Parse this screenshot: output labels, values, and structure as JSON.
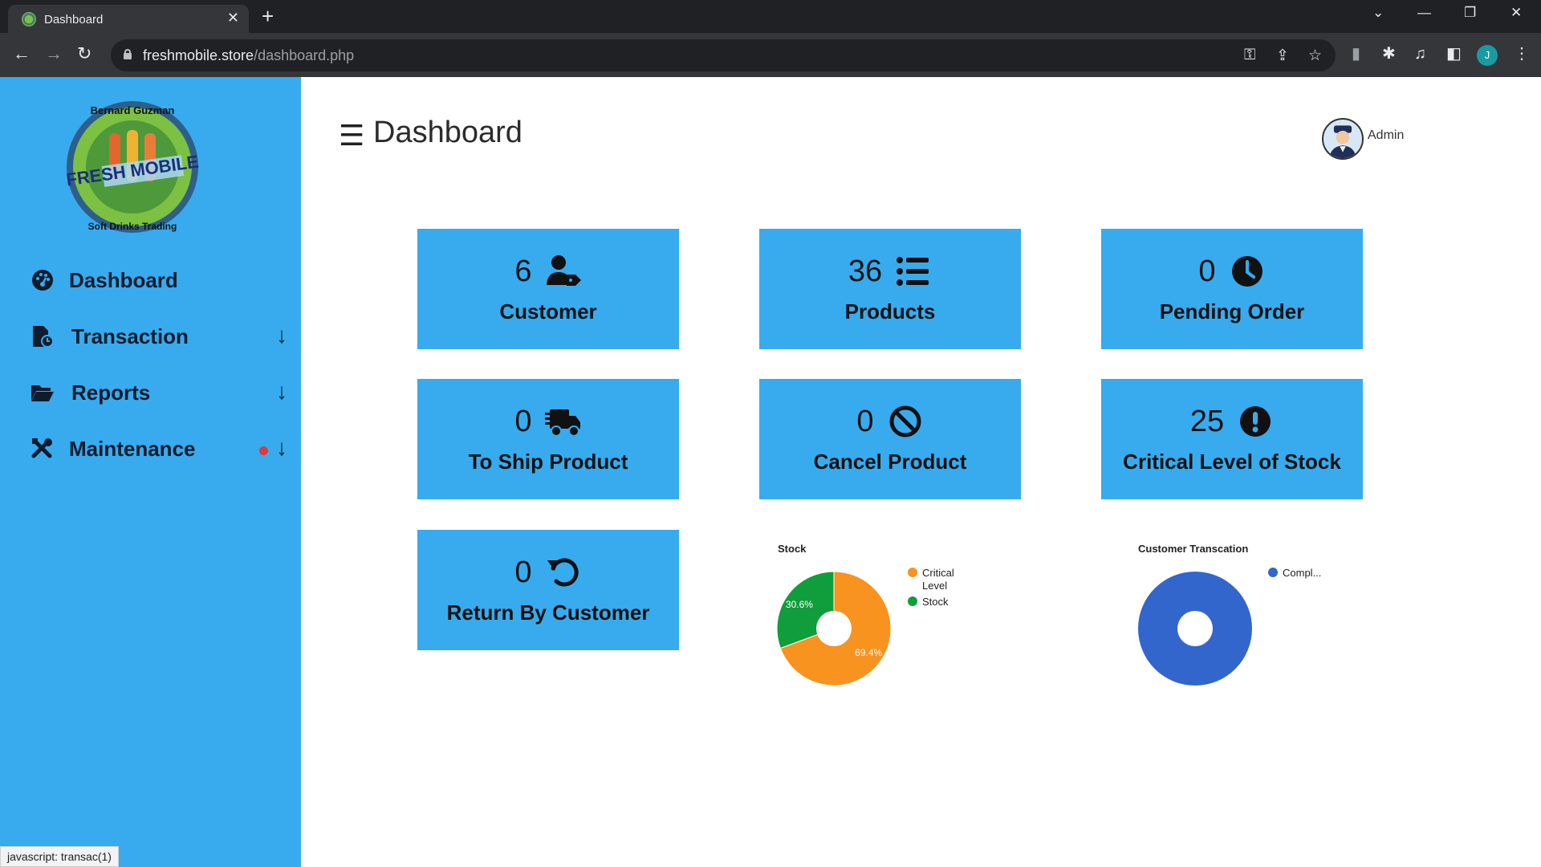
{
  "browser": {
    "tab_title": "Dashboard",
    "url_host": "freshmobile.store",
    "url_path": "/dashboard.php",
    "profile_initial": "J"
  },
  "sidebar": {
    "logo": {
      "top_text": "Bernard Guzman",
      "brand": "FRESH MOBILE",
      "bottom_text": "Soft Drinks Trading"
    },
    "items": [
      {
        "label": "Dashboard",
        "icon": "dashboard-gauge-icon",
        "has_arrow": false
      },
      {
        "label": "Transaction",
        "icon": "file-invoice-icon",
        "has_arrow": true
      },
      {
        "label": "Reports",
        "icon": "folder-open-icon",
        "has_arrow": true
      },
      {
        "label": "Maintenance",
        "icon": "tools-icon",
        "has_arrow": true,
        "has_notification": true
      }
    ],
    "accent_color": "#37abee"
  },
  "header": {
    "title": "Dashboard",
    "user_name": "Admin"
  },
  "cards": [
    {
      "count": "6",
      "label": "Customer",
      "icon": "user-tag-icon"
    },
    {
      "count": "36",
      "label": "Products",
      "icon": "list-icon"
    },
    {
      "count": "0",
      "label": "Pending Order",
      "icon": "clock-icon"
    },
    {
      "count": "0",
      "label": "To Ship Product",
      "icon": "shipping-truck-icon"
    },
    {
      "count": "0",
      "label": "Cancel Product",
      "icon": "ban-icon"
    },
    {
      "count": "25",
      "label": "Critical Level of Stock",
      "icon": "exclamation-circle-icon"
    },
    {
      "count": "0",
      "label": "Return By Customer",
      "icon": "undo-icon"
    }
  ],
  "chart_data": [
    {
      "type": "pie",
      "title": "Stock",
      "categories": [
        "Critical Level",
        "Stock"
      ],
      "values": [
        69.4,
        30.6
      ],
      "colors": [
        "#f7931e",
        "#109d3b"
      ],
      "labels": [
        "69.4%",
        "30.6%"
      ],
      "legend": "right"
    },
    {
      "type": "pie",
      "title": "Customer Transcation",
      "categories": [
        "Compl..."
      ],
      "values": [
        100
      ],
      "colors": [
        "#3366cc"
      ],
      "labels": [],
      "legend": "right"
    }
  ],
  "status_bar": "javascript: transac(1)"
}
